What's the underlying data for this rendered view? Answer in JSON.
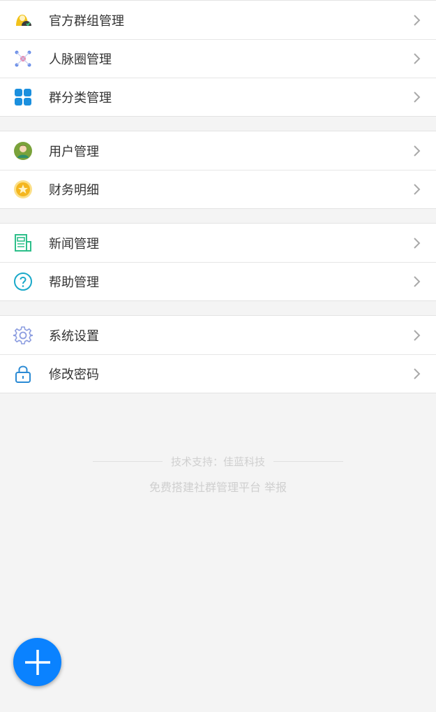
{
  "menu_groups": [
    {
      "items": [
        {
          "label": "官方群组管理",
          "icon": "official-group-icon"
        },
        {
          "label": "人脉圈管理",
          "icon": "network-icon"
        },
        {
          "label": "群分类管理",
          "icon": "category-grid-icon"
        }
      ]
    },
    {
      "items": [
        {
          "label": "用户管理",
          "icon": "user-avatar-icon"
        },
        {
          "label": "财务明细",
          "icon": "coin-star-icon"
        }
      ]
    },
    {
      "items": [
        {
          "label": "新闻管理",
          "icon": "news-icon"
        },
        {
          "label": "帮助管理",
          "icon": "help-icon"
        }
      ]
    },
    {
      "items": [
        {
          "label": "系统设置",
          "icon": "gear-icon"
        },
        {
          "label": "修改密码",
          "icon": "lock-icon"
        }
      ]
    }
  ],
  "footer": {
    "support": "技术支持：佳蓝科技",
    "free_platform_link": "免费搭建社群管理平台",
    "report_link": "举报"
  },
  "fab": {
    "icon": "plus-icon"
  },
  "colors": {
    "fab": "#0a82ff",
    "grid_icon": "#1a8fde",
    "news_icon": "#2dbf8a",
    "help_icon": "#1aa9c9",
    "gear_icon": "#8c9de0",
    "lock_icon": "#2a8ad4"
  }
}
